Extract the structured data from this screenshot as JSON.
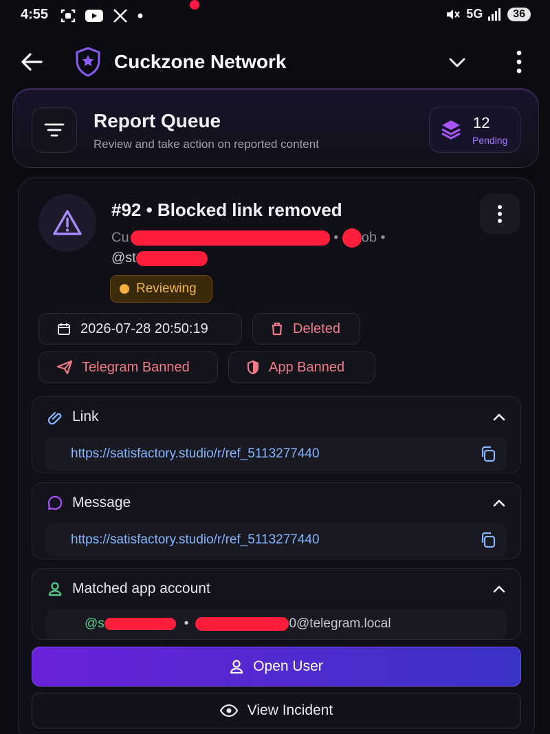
{
  "status_bar": {
    "time": "4:55",
    "network": "5G",
    "battery": "36",
    "left_icons": [
      "scan-icon",
      "youtube-icon",
      "x-icon",
      "dot-icon"
    ],
    "right_icons": [
      "mute-icon",
      "signal-icon"
    ]
  },
  "app_bar": {
    "title": "Cuckzone Network",
    "icons": [
      "back-arrow-icon",
      "shield-star-icon",
      "chevron-down-icon",
      "more-vertical-icon"
    ]
  },
  "queue": {
    "title": "Report Queue",
    "subtitle": "Review and take action on reported content",
    "pending_count": "12",
    "pending_label": "Pending"
  },
  "report": {
    "title": "#92 • Blocked link removed",
    "reporter_prefix": "Cu",
    "reporter_suffix": "ob •",
    "handle_prefix": "@st",
    "status": "Reviewing",
    "date": "2026-07-28 20:50:19",
    "chips": {
      "deleted": "Deleted",
      "telegram_banned": "Telegram Banned",
      "app_banned": "App Banned"
    }
  },
  "sections": {
    "link": {
      "label": "Link",
      "value": "https://satisfactory.studio/r/ref_5113277440"
    },
    "message": {
      "label": "Message",
      "value": "https://satisfactory.studio/r/ref_5113277440"
    },
    "matched": {
      "label": "Matched app account",
      "handle_prefix": "@s",
      "email_suffix": "0@telegram.local",
      "separator": "•"
    }
  },
  "actions": {
    "open_user": "Open User",
    "view_incident": "View Incident"
  },
  "colors": {
    "accent_purple": "#a855f7",
    "danger": "#f07a86",
    "warning": "#f5b041",
    "link": "#86b6ff",
    "success": "#4fd18b"
  }
}
